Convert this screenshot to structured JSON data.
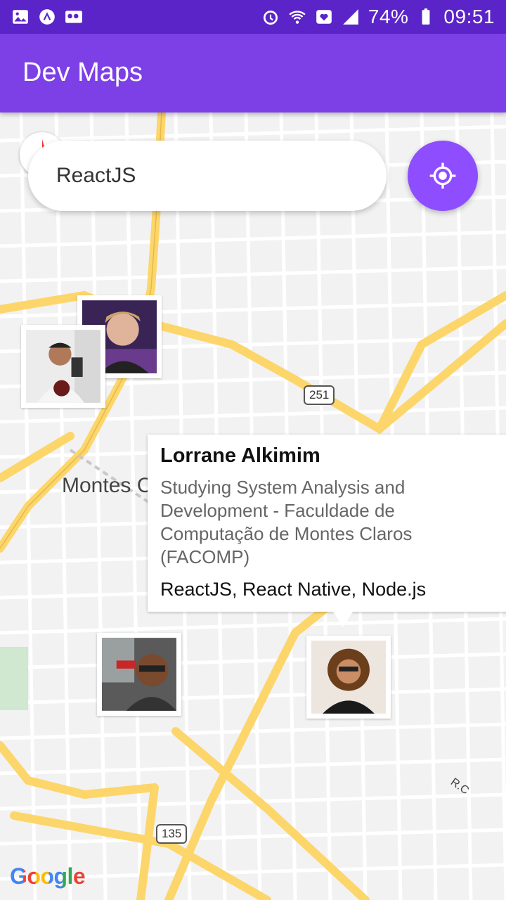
{
  "status_bar": {
    "battery": "74%",
    "time": "09:51",
    "left_icons": [
      "gallery-icon",
      "app-icon",
      "voicemail-icon"
    ],
    "right_icons": [
      "alarm-icon",
      "wifi-icon",
      "heart-icon",
      "signal-icon",
      "battery-icon"
    ]
  },
  "app_bar": {
    "title": "Dev Maps"
  },
  "search": {
    "value": "ReactJS",
    "placeholder": ""
  },
  "locate_button": {
    "icon": "my-location-icon",
    "color": "#8e4dff"
  },
  "map": {
    "city_label": "Montes C",
    "route_shields": [
      "251",
      "135"
    ],
    "road_label": "R.C",
    "logo": "Google"
  },
  "callout": {
    "name": "Lorrane Alkimim",
    "bio": "Studying System Analysis and Development - Faculdade de Computação de Montes Claros (FACOMP)",
    "techs": "ReactJS, React Native, Node.js"
  },
  "markers": [
    {
      "id": "dev-1"
    },
    {
      "id": "dev-2"
    },
    {
      "id": "dev-3"
    },
    {
      "id": "dev-4"
    }
  ],
  "colors": {
    "status_bar": "#5b24c9",
    "app_bar": "#7d40e7",
    "accent": "#8e4dff",
    "road_major": "#fcd66a"
  }
}
